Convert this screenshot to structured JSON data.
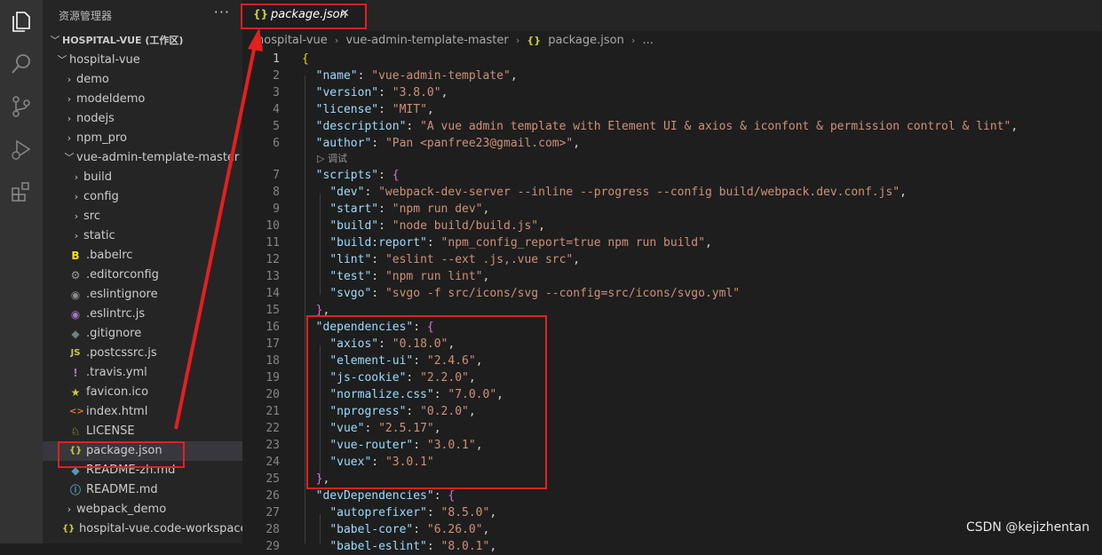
{
  "activity_bar": {
    "icons": [
      "explorer-icon",
      "search-icon",
      "source-control-icon",
      "run-debug-icon",
      "extensions-icon"
    ]
  },
  "sidebar": {
    "title": "资源管理器",
    "more": "···",
    "rows": [
      {
        "label": "HOSPITAL-VUE (工作区)",
        "chevron": "﹀",
        "icon": ""
      },
      {
        "label": "hospital-vue",
        "chevron": "﹀",
        "icon": ""
      },
      {
        "label": "demo",
        "chevron": "›",
        "icon": ""
      },
      {
        "label": "modeldemo",
        "chevron": "›",
        "icon": ""
      },
      {
        "label": "nodejs",
        "chevron": "›",
        "icon": ""
      },
      {
        "label": "npm_pro",
        "chevron": "›",
        "icon": ""
      },
      {
        "label": "vue-admin-template-master",
        "chevron": "﹀",
        "icon": ""
      },
      {
        "label": "build",
        "chevron": "›",
        "icon": ""
      },
      {
        "label": "config",
        "chevron": "›",
        "icon": ""
      },
      {
        "label": "src",
        "chevron": "›",
        "icon": ""
      },
      {
        "label": "static",
        "chevron": "›",
        "icon": ""
      },
      {
        "label": ".babelrc",
        "chevron": "",
        "icon": "B",
        "icon_color": "#f5de19"
      },
      {
        "label": ".editorconfig",
        "chevron": "",
        "icon": "⚙",
        "icon_color": "#9a9a9a"
      },
      {
        "label": ".eslintignore",
        "chevron": "",
        "icon": "◉",
        "icon_color": "#8a8a8a"
      },
      {
        "label": ".eslintrc.js",
        "chevron": "",
        "icon": "◉",
        "icon_color": "#a074c4"
      },
      {
        "label": ".gitignore",
        "chevron": "",
        "icon": "◆",
        "icon_color": "#6d8086"
      },
      {
        "label": ".postcssrc.js",
        "chevron": "",
        "icon": "JS",
        "icon_color": "#cbcb41"
      },
      {
        "label": ".travis.yml",
        "chevron": "",
        "icon": "!",
        "icon_color": "#a074c4"
      },
      {
        "label": "favicon.ico",
        "chevron": "",
        "icon": "★",
        "icon_color": "#cbcb41"
      },
      {
        "label": "index.html",
        "chevron": "",
        "icon": "<>",
        "icon_color": "#e37933"
      },
      {
        "label": "LICENSE",
        "chevron": "",
        "icon": "♘",
        "icon_color": "#cbcb41"
      },
      {
        "label": "package.json",
        "chevron": "",
        "icon": "{}",
        "icon_color": "#cbcb41"
      },
      {
        "label": "README-zh.md",
        "chevron": "",
        "icon": "◆",
        "icon_color": "#519aba"
      },
      {
        "label": "README.md",
        "chevron": "",
        "icon": "ⓘ",
        "icon_color": "#519aba"
      },
      {
        "label": "webpack_demo",
        "chevron": "›",
        "icon": ""
      },
      {
        "label": "hospital-vue.code-workspace",
        "chevron": "",
        "icon": "{}",
        "icon_color": "#cbcb41"
      }
    ]
  },
  "tab": {
    "icon": "{}",
    "name": "package.json",
    "close": "✕"
  },
  "breadcrumb": {
    "items": [
      "hospital-vue",
      "vue-admin-template-master",
      "package.json",
      "..."
    ],
    "separator": "›",
    "file_icon": "{}"
  },
  "codelens": "▷ 调试",
  "code_lines": [
    {
      "n": "1",
      "segs": [
        [
          "b1",
          "{"
        ]
      ]
    },
    {
      "n": "2",
      "segs": [
        [
          "p",
          "  "
        ],
        [
          "k",
          "\"name\""
        ],
        [
          "p",
          ": "
        ],
        [
          "s",
          "\"vue-admin-template\""
        ],
        [
          "p",
          ","
        ]
      ]
    },
    {
      "n": "3",
      "segs": [
        [
          "p",
          "  "
        ],
        [
          "k",
          "\"version\""
        ],
        [
          "p",
          ": "
        ],
        [
          "s",
          "\"3.8.0\""
        ],
        [
          "p",
          ","
        ]
      ]
    },
    {
      "n": "4",
      "segs": [
        [
          "p",
          "  "
        ],
        [
          "k",
          "\"license\""
        ],
        [
          "p",
          ": "
        ],
        [
          "s",
          "\"MIT\""
        ],
        [
          "p",
          ","
        ]
      ]
    },
    {
      "n": "5",
      "segs": [
        [
          "p",
          "  "
        ],
        [
          "k",
          "\"description\""
        ],
        [
          "p",
          ": "
        ],
        [
          "s",
          "\"A vue admin template with Element UI & axios & iconfont & permission control & lint\""
        ],
        [
          "p",
          ","
        ]
      ]
    },
    {
      "n": "6",
      "segs": [
        [
          "p",
          "  "
        ],
        [
          "k",
          "\"author\""
        ],
        [
          "p",
          ": "
        ],
        [
          "s",
          "\"Pan <panfree23@gmail.com>\""
        ],
        [
          "p",
          ","
        ]
      ]
    },
    {
      "n": "7",
      "segs": [
        [
          "p",
          "  "
        ],
        [
          "k",
          "\"scripts\""
        ],
        [
          "p",
          ": "
        ],
        [
          "b2",
          "{"
        ]
      ]
    },
    {
      "n": "8",
      "segs": [
        [
          "p",
          "    "
        ],
        [
          "k",
          "\"dev\""
        ],
        [
          "p",
          ": "
        ],
        [
          "s",
          "\"webpack-dev-server --inline --progress --config build/webpack.dev.conf.js\""
        ],
        [
          "p",
          ","
        ]
      ]
    },
    {
      "n": "9",
      "segs": [
        [
          "p",
          "    "
        ],
        [
          "k",
          "\"start\""
        ],
        [
          "p",
          ": "
        ],
        [
          "s",
          "\"npm run dev\""
        ],
        [
          "p",
          ","
        ]
      ]
    },
    {
      "n": "10",
      "segs": [
        [
          "p",
          "    "
        ],
        [
          "k",
          "\"build\""
        ],
        [
          "p",
          ": "
        ],
        [
          "s",
          "\"node build/build.js\""
        ],
        [
          "p",
          ","
        ]
      ]
    },
    {
      "n": "11",
      "segs": [
        [
          "p",
          "    "
        ],
        [
          "k",
          "\"build:report\""
        ],
        [
          "p",
          ": "
        ],
        [
          "s",
          "\"npm_config_report=true npm run build\""
        ],
        [
          "p",
          ","
        ]
      ]
    },
    {
      "n": "12",
      "segs": [
        [
          "p",
          "    "
        ],
        [
          "k",
          "\"lint\""
        ],
        [
          "p",
          ": "
        ],
        [
          "s",
          "\"eslint --ext .js,.vue src\""
        ],
        [
          "p",
          ","
        ]
      ]
    },
    {
      "n": "13",
      "segs": [
        [
          "p",
          "    "
        ],
        [
          "k",
          "\"test\""
        ],
        [
          "p",
          ": "
        ],
        [
          "s",
          "\"npm run lint\""
        ],
        [
          "p",
          ","
        ]
      ]
    },
    {
      "n": "14",
      "segs": [
        [
          "p",
          "    "
        ],
        [
          "k",
          "\"svgo\""
        ],
        [
          "p",
          ": "
        ],
        [
          "s",
          "\"svgo -f src/icons/svg --config=src/icons/svgo.yml\""
        ]
      ]
    },
    {
      "n": "15",
      "segs": [
        [
          "p",
          "  "
        ],
        [
          "b2",
          "}"
        ],
        [
          "p",
          ","
        ]
      ]
    },
    {
      "n": "16",
      "segs": [
        [
          "p",
          "  "
        ],
        [
          "k",
          "\"dependencies\""
        ],
        [
          "p",
          ": "
        ],
        [
          "b2",
          "{"
        ]
      ]
    },
    {
      "n": "17",
      "segs": [
        [
          "p",
          "    "
        ],
        [
          "k",
          "\"axios\""
        ],
        [
          "p",
          ": "
        ],
        [
          "s",
          "\"0.18.0\""
        ],
        [
          "p",
          ","
        ]
      ]
    },
    {
      "n": "18",
      "segs": [
        [
          "p",
          "    "
        ],
        [
          "k",
          "\"element-ui\""
        ],
        [
          "p",
          ": "
        ],
        [
          "s",
          "\"2.4.6\""
        ],
        [
          "p",
          ","
        ]
      ]
    },
    {
      "n": "19",
      "segs": [
        [
          "p",
          "    "
        ],
        [
          "k",
          "\"js-cookie\""
        ],
        [
          "p",
          ": "
        ],
        [
          "s",
          "\"2.2.0\""
        ],
        [
          "p",
          ","
        ]
      ]
    },
    {
      "n": "20",
      "segs": [
        [
          "p",
          "    "
        ],
        [
          "k",
          "\"normalize.css\""
        ],
        [
          "p",
          ": "
        ],
        [
          "s",
          "\"7.0.0\""
        ],
        [
          "p",
          ","
        ]
      ]
    },
    {
      "n": "21",
      "segs": [
        [
          "p",
          "    "
        ],
        [
          "k",
          "\"nprogress\""
        ],
        [
          "p",
          ": "
        ],
        [
          "s",
          "\"0.2.0\""
        ],
        [
          "p",
          ","
        ]
      ]
    },
    {
      "n": "22",
      "segs": [
        [
          "p",
          "    "
        ],
        [
          "k",
          "\"vue\""
        ],
        [
          "p",
          ": "
        ],
        [
          "s",
          "\"2.5.17\""
        ],
        [
          "p",
          ","
        ]
      ]
    },
    {
      "n": "23",
      "segs": [
        [
          "p",
          "    "
        ],
        [
          "k",
          "\"vue-router\""
        ],
        [
          "p",
          ": "
        ],
        [
          "s",
          "\"3.0.1\""
        ],
        [
          "p",
          ","
        ]
      ]
    },
    {
      "n": "24",
      "segs": [
        [
          "p",
          "    "
        ],
        [
          "k",
          "\"vuex\""
        ],
        [
          "p",
          ": "
        ],
        [
          "s",
          "\"3.0.1\""
        ]
      ]
    },
    {
      "n": "25",
      "segs": [
        [
          "p",
          "  "
        ],
        [
          "b2",
          "}"
        ],
        [
          "p",
          ","
        ]
      ]
    },
    {
      "n": "26",
      "segs": [
        [
          "p",
          "  "
        ],
        [
          "k",
          "\"devDependencies\""
        ],
        [
          "p",
          ": "
        ],
        [
          "b2",
          "{"
        ]
      ]
    },
    {
      "n": "27",
      "segs": [
        [
          "p",
          "    "
        ],
        [
          "k",
          "\"autoprefixer\""
        ],
        [
          "p",
          ": "
        ],
        [
          "s",
          "\"8.5.0\""
        ],
        [
          "p",
          ","
        ]
      ]
    },
    {
      "n": "28",
      "segs": [
        [
          "p",
          "    "
        ],
        [
          "k",
          "\"babel-core\""
        ],
        [
          "p",
          ": "
        ],
        [
          "s",
          "\"6.26.0\""
        ],
        [
          "p",
          ","
        ]
      ]
    },
    {
      "n": "29",
      "segs": [
        [
          "p",
          "    "
        ],
        [
          "k",
          "\"babel-eslint\""
        ],
        [
          "p",
          ": "
        ],
        [
          "s",
          "\"8.0.1\""
        ],
        [
          "p",
          ","
        ]
      ]
    }
  ],
  "watermark": "CSDN @kejizhentan",
  "colors": {
    "annotation_red": "#e51f1f",
    "activity_bar": "#333333",
    "sidebar": "#252526",
    "editor": "#1e1e1e"
  }
}
